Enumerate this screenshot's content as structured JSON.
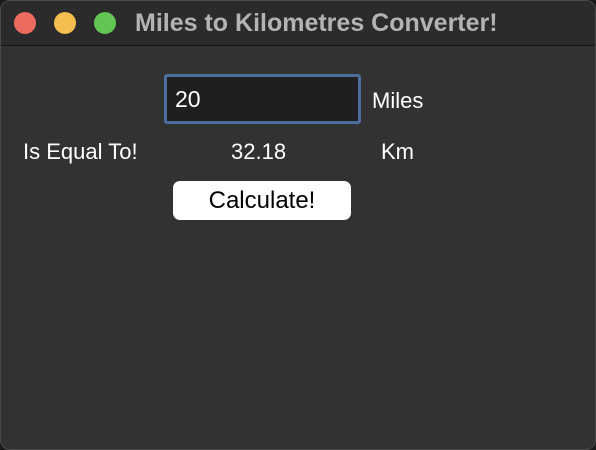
{
  "window": {
    "title": "Miles to Kilometres Converter!"
  },
  "traffic_lights": {
    "close_color": "#ed6a5e",
    "minimize_color": "#f5bf4f",
    "maximize_color": "#62c554"
  },
  "form": {
    "miles_value": "20",
    "miles_unit": "Miles",
    "equal_label": "Is Equal To!",
    "result_value": "32.18",
    "km_unit": "Km",
    "calculate_label": "Calculate!"
  },
  "colors": {
    "background": "#323232",
    "input_focus_border": "#4c6d9e",
    "text": "#ffffff",
    "button_bg": "#ffffff"
  }
}
